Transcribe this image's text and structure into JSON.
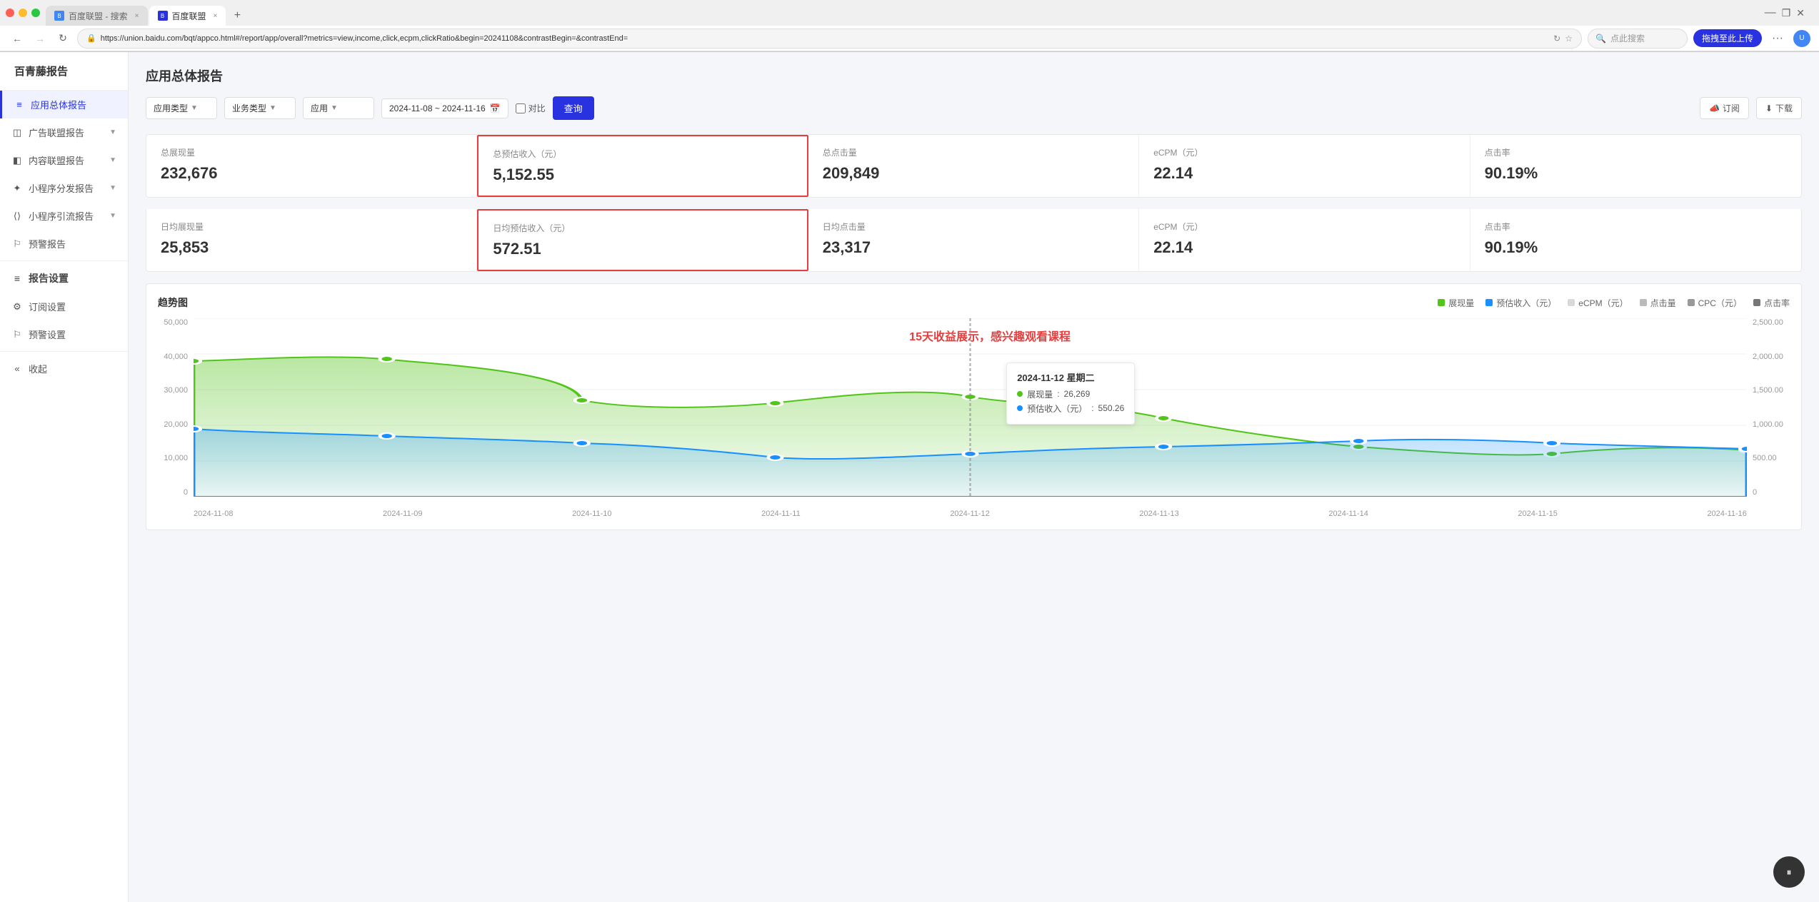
{
  "browser": {
    "tabs": [
      {
        "id": "tab1",
        "label": "百度联盟 - 搜索",
        "icon": "B",
        "active": false
      },
      {
        "id": "tab2",
        "label": "百度联盟",
        "icon": "B",
        "active": true
      }
    ],
    "url": "https://union.baidu.com/bqt/appco.html#/report/app/overall?metrics=view,income,click,ecpm,clickRatio&begin=20241108&contrastBegin=&contrastEnd=",
    "search_placeholder": "点此搜索",
    "action_btn": "拖拽至此上传",
    "more": "···"
  },
  "sidebar": {
    "logo": "百青藤报告",
    "items": [
      {
        "id": "app-overall",
        "label": "应用总体报告",
        "active": true,
        "icon": "≡"
      },
      {
        "id": "ad-alliance",
        "label": "广告联盟报告",
        "active": false,
        "icon": "◫",
        "has_arrow": true
      },
      {
        "id": "content-alliance",
        "label": "内容联盟报告",
        "active": false,
        "icon": "◧",
        "has_arrow": true
      },
      {
        "id": "mini-program-dist",
        "label": "小程序分发报告",
        "active": false,
        "icon": "✦",
        "has_arrow": true
      },
      {
        "id": "mini-program-flow",
        "label": "小程序引流报告",
        "active": false,
        "icon": "⟨⟩",
        "has_arrow": true
      },
      {
        "id": "warning-report",
        "label": "预警报告",
        "active": false,
        "icon": "⚐"
      }
    ],
    "settings_items": [
      {
        "id": "report-settings",
        "label": "报告设置",
        "icon": "≡"
      },
      {
        "id": "subscription-settings",
        "label": "订阅设置",
        "icon": "⚙"
      },
      {
        "id": "warning-settings",
        "label": "预警设置",
        "icon": "⚐"
      },
      {
        "id": "collapse",
        "label": "收起",
        "icon": "«"
      }
    ]
  },
  "main": {
    "page_title": "应用总体报告",
    "filters": {
      "app_type": "应用类型",
      "business_type": "业务类型",
      "app": "应用",
      "date_range": "2024-11-08 ~ 2024-11-16",
      "compare_label": "对比",
      "query_btn": "查询",
      "subscribe_btn": "订阅",
      "download_btn": "下载"
    },
    "stats_row1": [
      {
        "id": "total-views",
        "label": "总展现量",
        "value": "232,676",
        "highlighted": false
      },
      {
        "id": "total-income",
        "label": "总预估收入（元）",
        "value": "5,152.55",
        "highlighted": true
      },
      {
        "id": "total-clicks",
        "label": "总点击量",
        "value": "209,849",
        "highlighted": false
      },
      {
        "id": "ecpm",
        "label": "eCPM（元）",
        "value": "22.14",
        "highlighted": false
      },
      {
        "id": "click-rate",
        "label": "点击率",
        "value": "90.19%",
        "highlighted": false
      }
    ],
    "stats_row2": [
      {
        "id": "daily-views",
        "label": "日均展现量",
        "value": "25,853",
        "highlighted": false
      },
      {
        "id": "daily-income",
        "label": "日均预估收入（元）",
        "value": "572.51",
        "highlighted": true
      },
      {
        "id": "daily-clicks",
        "label": "日均点击量",
        "value": "23,317",
        "highlighted": false
      },
      {
        "id": "daily-ecpm",
        "label": "eCPM（元）",
        "value": "22.14",
        "highlighted": false
      },
      {
        "id": "daily-click-rate",
        "label": "点击率",
        "value": "90.19%",
        "highlighted": false
      }
    ],
    "promo_text": "15天收益展示，感兴趣观看课程",
    "chart": {
      "title": "趋势图",
      "legend": [
        {
          "id": "views",
          "label": "展现量",
          "color": "#52c41a"
        },
        {
          "id": "income",
          "label": "预估收入（元）",
          "color": "#1890ff"
        },
        {
          "id": "ecpm",
          "label": "eCPM（元）",
          "color": "#d9d9d9"
        },
        {
          "id": "clicks",
          "label": "点击量",
          "color": "#bbb"
        },
        {
          "id": "cpc",
          "label": "CPC（元）",
          "color": "#999"
        },
        {
          "id": "click-rate",
          "label": "点击率",
          "color": "#777"
        }
      ],
      "y_left": [
        "50,000",
        "40,000",
        "30,000",
        "20,000",
        "10,000",
        "0"
      ],
      "y_right": [
        "2,500.00",
        "2,000.00",
        "1,500.00",
        "1,000.00",
        "500.00",
        "0"
      ],
      "x_labels": [
        "2024-11-08",
        "2024-11-09",
        "2024-11-10",
        "2024-11-11",
        "2024-11-12",
        "2024-11-13",
        "2024-11-14",
        "2024-11-15",
        "2024-11-16"
      ],
      "tooltip": {
        "date": "2024-11-12 星期二",
        "views_label": "展现量",
        "views_value": "26,269",
        "income_label": "预估收入（元）",
        "income_value": "550.26"
      },
      "views_data": [
        38000,
        38500,
        35000,
        27000,
        19000,
        26269,
        28000,
        26500,
        22000,
        14000
      ],
      "income_data": [
        19000,
        17500,
        16000,
        13500,
        11500,
        10000,
        9500,
        10000,
        12000,
        14000,
        16500,
        18000,
        16000,
        13500,
        11000
      ]
    }
  }
}
